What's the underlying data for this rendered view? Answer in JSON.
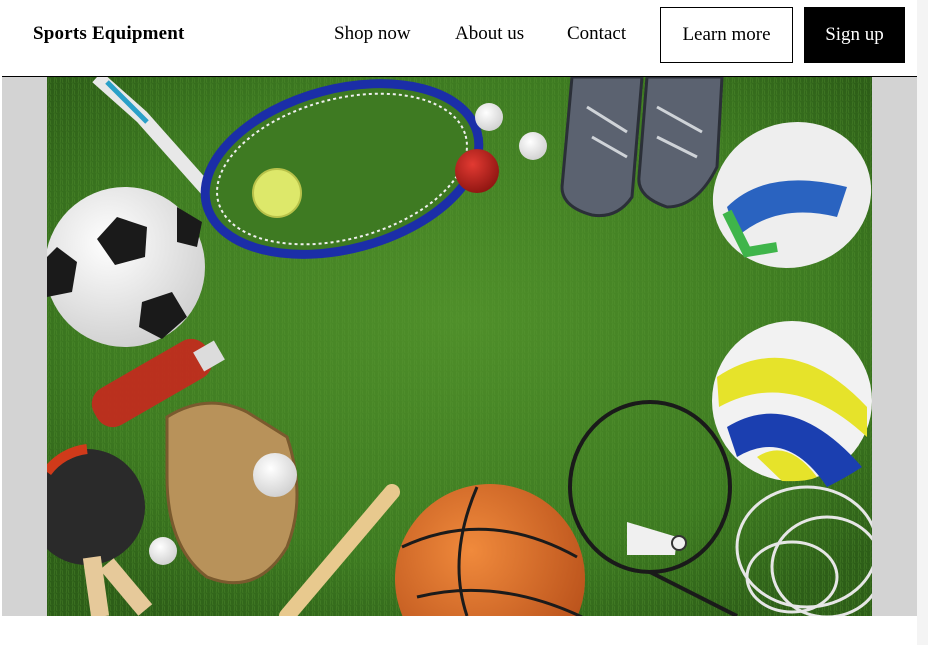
{
  "header": {
    "brand": "Sports Equipment",
    "nav": {
      "shop": "Shop now",
      "about": "About us",
      "contact": "Contact"
    },
    "learn_more": "Learn more",
    "sign_up": "Sign up"
  },
  "hero": {
    "image_icon": "sports-equipment-photo"
  },
  "colors": {
    "grass": "#3f7a22",
    "panel": "#d3d3d3",
    "button_dark": "#000000"
  }
}
